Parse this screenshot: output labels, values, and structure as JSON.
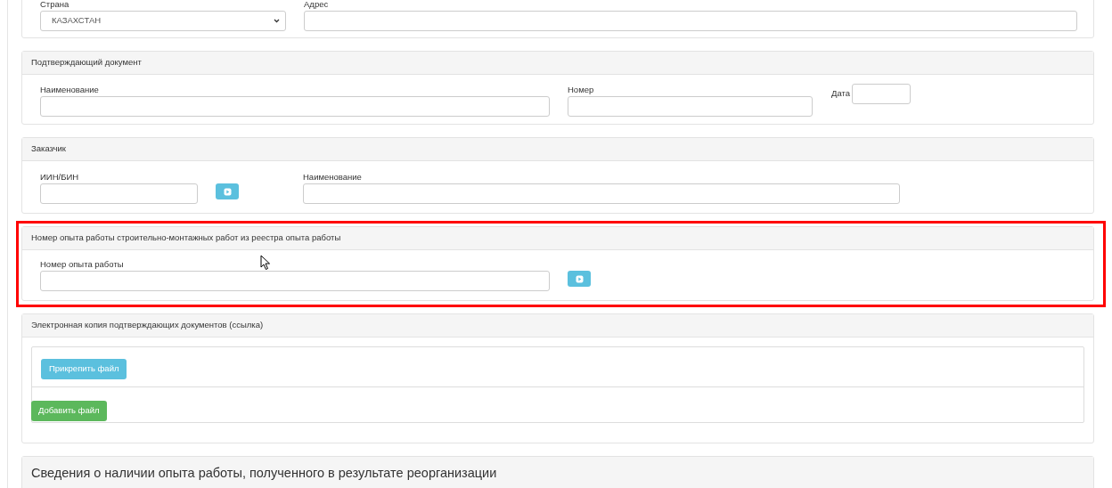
{
  "sections": [
    {
      "kind": "form",
      "highlighted": false,
      "fields": [
        {
          "kind": "select",
          "label": "Страна",
          "value": "КАЗАХСТАН",
          "lookup": false
        },
        {
          "kind": "text",
          "label": "Адрес",
          "lookup": false
        }
      ]
    },
    {
      "kind": "form",
      "title": "Подтверждающий документ",
      "highlighted": false,
      "fields": [
        {
          "kind": "text",
          "label": "Наименование",
          "lookup": false
        },
        {
          "kind": "text",
          "label": "Номер",
          "lookup": false
        },
        {
          "kind": "inline",
          "label": "Дата",
          "lookup": false
        }
      ]
    },
    {
      "kind": "form",
      "title": "Заказчик",
      "highlighted": false,
      "fields": [
        {
          "kind": "text",
          "label": "ИИН/БИН",
          "lookup": true
        },
        {
          "kind": "text",
          "label": "Наименование",
          "lookup": false
        }
      ]
    },
    {
      "kind": "form",
      "title": "Номер опыта работы строительно-монтажных работ из реестра опыта работы",
      "highlighted": true,
      "fields": [
        {
          "kind": "text",
          "label": "Номер опыта работы",
          "lookup": true
        }
      ]
    },
    {
      "kind": "files",
      "title": "Электронная копия подтверждающих документов (ссылка)",
      "highlighted": false,
      "attach_button": "Прикрепить файл",
      "add_button": "Добавить файл"
    },
    {
      "kind": "heading",
      "title": "Сведения о наличии опыта работы, полученного в результате реорганизации",
      "highlighted": false
    }
  ]
}
